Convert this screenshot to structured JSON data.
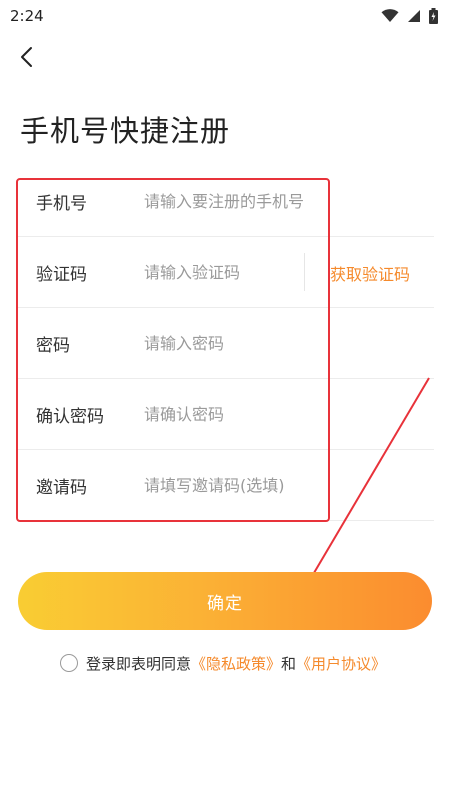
{
  "status_bar": {
    "time": "2:24",
    "icons": [
      "wifi-icon",
      "cell-signal-icon",
      "battery-icon"
    ]
  },
  "page": {
    "title": "手机号快捷注册"
  },
  "form": {
    "phone": {
      "label": "手机号",
      "placeholder": "请输入要注册的手机号",
      "value": ""
    },
    "code": {
      "label": "验证码",
      "placeholder": "请输入验证码",
      "value": "",
      "get_code_label": "获取验证码"
    },
    "password": {
      "label": "密码",
      "placeholder": "请输入密码",
      "value": ""
    },
    "confirm_password": {
      "label": "确认密码",
      "placeholder": "请确认密码",
      "value": ""
    },
    "invite": {
      "label": "邀请码",
      "placeholder": "请填写邀请码(选填)",
      "value": ""
    }
  },
  "actions": {
    "confirm_label": "确定"
  },
  "agreement": {
    "prefix": "登录即表明同意",
    "privacy_link": "《隐私政策》",
    "and": "和",
    "user_link": "《用户协议》",
    "checked": false
  },
  "colors": {
    "accent": "#f58a2c",
    "button_gradient_start": "#f9cd33",
    "button_gradient_end": "#fb8c2f",
    "highlight": "#e8323a"
  }
}
